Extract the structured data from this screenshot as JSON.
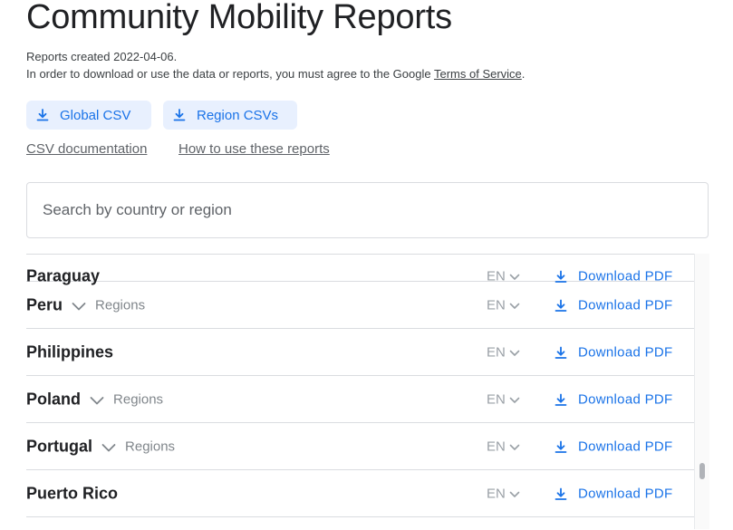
{
  "page": {
    "title": "Community Mobility Reports",
    "created": "Reports created 2022-04-06.",
    "terms_prefix": "In order to download or use the data or reports, you must agree to the Google ",
    "terms_link": "Terms of Service",
    "terms_suffix": "."
  },
  "buttons": {
    "global_csv": "Global CSV",
    "region_csvs": "Region CSVs"
  },
  "links": {
    "csv_documentation": "CSV documentation",
    "how_to_use": "How to use these reports"
  },
  "search": {
    "placeholder": "Search by country or region",
    "value": ""
  },
  "rows": [
    {
      "name": "Paraguay",
      "has_regions": false,
      "lang": "EN",
      "download": "Download PDF"
    },
    {
      "name": "Peru",
      "has_regions": true,
      "regions_label": "Regions",
      "lang": "EN",
      "download": "Download PDF"
    },
    {
      "name": "Philippines",
      "has_regions": false,
      "lang": "EN",
      "download": "Download PDF"
    },
    {
      "name": "Poland",
      "has_regions": true,
      "regions_label": "Regions",
      "lang": "EN",
      "download": "Download PDF"
    },
    {
      "name": "Portugal",
      "has_regions": true,
      "regions_label": "Regions",
      "lang": "EN",
      "download": "Download PDF"
    },
    {
      "name": "Puerto Rico",
      "has_regions": false,
      "lang": "EN",
      "download": "Download PDF"
    }
  ],
  "icons": {
    "download": "download-icon",
    "expand": "chevron-down-icon"
  },
  "colors": {
    "accent": "#1a73e8",
    "button_bg": "#e8f0fe",
    "muted": "#80868b"
  }
}
